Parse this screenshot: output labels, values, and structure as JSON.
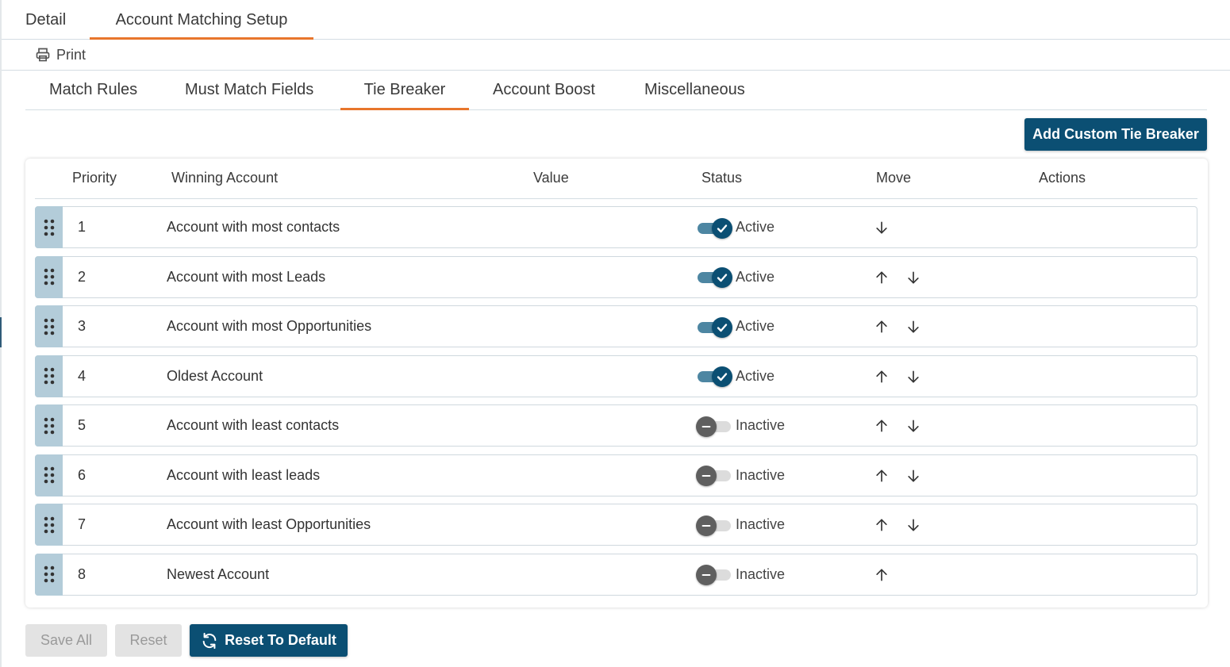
{
  "top_tabs": [
    {
      "label": "Detail"
    },
    {
      "label": "Account Matching Setup",
      "active": true
    }
  ],
  "toolbar": {
    "print_label": "Print"
  },
  "sub_tabs": [
    {
      "label": "Match Rules"
    },
    {
      "label": "Must Match Fields"
    },
    {
      "label": "Tie Breaker",
      "active": true
    },
    {
      "label": "Account Boost"
    },
    {
      "label": "Miscellaneous"
    }
  ],
  "add_button_label": "Add Custom Tie Breaker",
  "table": {
    "headers": [
      "Priority",
      "Winning Account",
      "Value",
      "Status",
      "Move",
      "Actions"
    ],
    "rows": [
      {
        "priority": "1",
        "winning_account": "Account with most contacts",
        "status": "Active",
        "active": true,
        "move": [
          "down"
        ]
      },
      {
        "priority": "2",
        "winning_account": "Account with most Leads",
        "status": "Active",
        "active": true,
        "move": [
          "up",
          "down"
        ]
      },
      {
        "priority": "3",
        "winning_account": "Account with most Opportunities",
        "status": "Active",
        "active": true,
        "move": [
          "up",
          "down"
        ]
      },
      {
        "priority": "4",
        "winning_account": "Oldest Account",
        "status": "Active",
        "active": true,
        "move": [
          "up",
          "down"
        ]
      },
      {
        "priority": "5",
        "winning_account": "Account with least contacts",
        "status": "Inactive",
        "active": false,
        "move": [
          "up",
          "down"
        ]
      },
      {
        "priority": "6",
        "winning_account": "Account with least leads",
        "status": "Inactive",
        "active": false,
        "move": [
          "up",
          "down"
        ]
      },
      {
        "priority": "7",
        "winning_account": "Account with least Opportunities",
        "status": "Inactive",
        "active": false,
        "move": [
          "up",
          "down"
        ]
      },
      {
        "priority": "8",
        "winning_account": "Newest Account",
        "status": "Inactive",
        "active": false,
        "move": [
          "up"
        ]
      }
    ]
  },
  "footer": {
    "save_all_label": "Save All",
    "reset_label": "Reset",
    "reset_default_label": "Reset To Default"
  },
  "colors": {
    "accent": "#e8762c",
    "primary": "#0b4f73",
    "toggle_on_track": "#4d86a2",
    "handle": "#b3ccd9"
  },
  "icons": {
    "print": "printer-icon",
    "drag": "drag-handle-icon",
    "up": "arrow-up-icon",
    "down": "arrow-down-icon",
    "check": "check-icon",
    "minus": "minus-icon",
    "refresh": "refresh-icon"
  }
}
